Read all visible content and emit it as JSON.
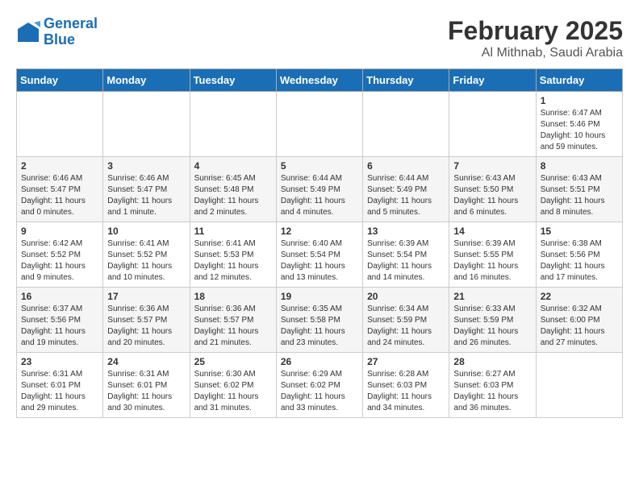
{
  "logo": {
    "line1": "General",
    "line2": "Blue"
  },
  "title": "February 2025",
  "subtitle": "Al Mithnab, Saudi Arabia",
  "days_of_week": [
    "Sunday",
    "Monday",
    "Tuesday",
    "Wednesday",
    "Thursday",
    "Friday",
    "Saturday"
  ],
  "weeks": [
    [
      {
        "day": "",
        "info": ""
      },
      {
        "day": "",
        "info": ""
      },
      {
        "day": "",
        "info": ""
      },
      {
        "day": "",
        "info": ""
      },
      {
        "day": "",
        "info": ""
      },
      {
        "day": "",
        "info": ""
      },
      {
        "day": "1",
        "info": "Sunrise: 6:47 AM\nSunset: 5:46 PM\nDaylight: 10 hours and 59 minutes."
      }
    ],
    [
      {
        "day": "2",
        "info": "Sunrise: 6:46 AM\nSunset: 5:47 PM\nDaylight: 11 hours and 0 minutes."
      },
      {
        "day": "3",
        "info": "Sunrise: 6:46 AM\nSunset: 5:47 PM\nDaylight: 11 hours and 1 minute."
      },
      {
        "day": "4",
        "info": "Sunrise: 6:45 AM\nSunset: 5:48 PM\nDaylight: 11 hours and 2 minutes."
      },
      {
        "day": "5",
        "info": "Sunrise: 6:44 AM\nSunset: 5:49 PM\nDaylight: 11 hours and 4 minutes."
      },
      {
        "day": "6",
        "info": "Sunrise: 6:44 AM\nSunset: 5:49 PM\nDaylight: 11 hours and 5 minutes."
      },
      {
        "day": "7",
        "info": "Sunrise: 6:43 AM\nSunset: 5:50 PM\nDaylight: 11 hours and 6 minutes."
      },
      {
        "day": "8",
        "info": "Sunrise: 6:43 AM\nSunset: 5:51 PM\nDaylight: 11 hours and 8 minutes."
      }
    ],
    [
      {
        "day": "9",
        "info": "Sunrise: 6:42 AM\nSunset: 5:52 PM\nDaylight: 11 hours and 9 minutes."
      },
      {
        "day": "10",
        "info": "Sunrise: 6:41 AM\nSunset: 5:52 PM\nDaylight: 11 hours and 10 minutes."
      },
      {
        "day": "11",
        "info": "Sunrise: 6:41 AM\nSunset: 5:53 PM\nDaylight: 11 hours and 12 minutes."
      },
      {
        "day": "12",
        "info": "Sunrise: 6:40 AM\nSunset: 5:54 PM\nDaylight: 11 hours and 13 minutes."
      },
      {
        "day": "13",
        "info": "Sunrise: 6:39 AM\nSunset: 5:54 PM\nDaylight: 11 hours and 14 minutes."
      },
      {
        "day": "14",
        "info": "Sunrise: 6:39 AM\nSunset: 5:55 PM\nDaylight: 11 hours and 16 minutes."
      },
      {
        "day": "15",
        "info": "Sunrise: 6:38 AM\nSunset: 5:56 PM\nDaylight: 11 hours and 17 minutes."
      }
    ],
    [
      {
        "day": "16",
        "info": "Sunrise: 6:37 AM\nSunset: 5:56 PM\nDaylight: 11 hours and 19 minutes."
      },
      {
        "day": "17",
        "info": "Sunrise: 6:36 AM\nSunset: 5:57 PM\nDaylight: 11 hours and 20 minutes."
      },
      {
        "day": "18",
        "info": "Sunrise: 6:36 AM\nSunset: 5:57 PM\nDaylight: 11 hours and 21 minutes."
      },
      {
        "day": "19",
        "info": "Sunrise: 6:35 AM\nSunset: 5:58 PM\nDaylight: 11 hours and 23 minutes."
      },
      {
        "day": "20",
        "info": "Sunrise: 6:34 AM\nSunset: 5:59 PM\nDaylight: 11 hours and 24 minutes."
      },
      {
        "day": "21",
        "info": "Sunrise: 6:33 AM\nSunset: 5:59 PM\nDaylight: 11 hours and 26 minutes."
      },
      {
        "day": "22",
        "info": "Sunrise: 6:32 AM\nSunset: 6:00 PM\nDaylight: 11 hours and 27 minutes."
      }
    ],
    [
      {
        "day": "23",
        "info": "Sunrise: 6:31 AM\nSunset: 6:01 PM\nDaylight: 11 hours and 29 minutes."
      },
      {
        "day": "24",
        "info": "Sunrise: 6:31 AM\nSunset: 6:01 PM\nDaylight: 11 hours and 30 minutes."
      },
      {
        "day": "25",
        "info": "Sunrise: 6:30 AM\nSunset: 6:02 PM\nDaylight: 11 hours and 31 minutes."
      },
      {
        "day": "26",
        "info": "Sunrise: 6:29 AM\nSunset: 6:02 PM\nDaylight: 11 hours and 33 minutes."
      },
      {
        "day": "27",
        "info": "Sunrise: 6:28 AM\nSunset: 6:03 PM\nDaylight: 11 hours and 34 minutes."
      },
      {
        "day": "28",
        "info": "Sunrise: 6:27 AM\nSunset: 6:03 PM\nDaylight: 11 hours and 36 minutes."
      },
      {
        "day": "",
        "info": ""
      }
    ]
  ]
}
